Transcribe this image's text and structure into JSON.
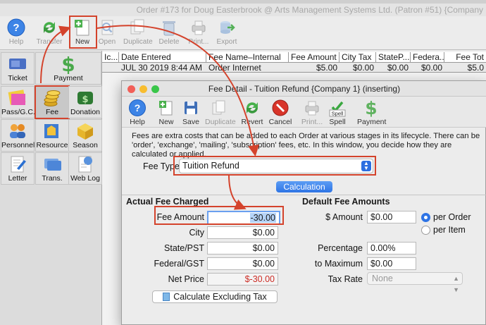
{
  "order_window": {
    "title": "Order #173 for Doug Easterbrook @ Arts Management Systems Ltd. (Patron #51) {Company",
    "toolbar": [
      {
        "id": "help",
        "label": "Help"
      },
      {
        "id": "transfer",
        "label": "Transfer"
      },
      {
        "id": "new",
        "label": "New"
      },
      {
        "id": "open",
        "label": "Open"
      },
      {
        "id": "duplicate",
        "label": "Duplicate"
      },
      {
        "id": "delete",
        "label": "Delete"
      },
      {
        "id": "print",
        "label": "Print..."
      },
      {
        "id": "export",
        "label": "Export"
      }
    ],
    "modules": [
      {
        "id": "ticket",
        "label": "Ticket"
      },
      {
        "id": "payment",
        "label": "Payment"
      },
      {
        "id": "pass",
        "label": "Pass/G.C."
      },
      {
        "id": "fee",
        "label": "Fee"
      },
      {
        "id": "donation",
        "label": "Donation"
      },
      {
        "id": "personnel",
        "label": "Personnel"
      },
      {
        "id": "resource",
        "label": "Resource"
      },
      {
        "id": "season",
        "label": "Season"
      },
      {
        "id": "letter",
        "label": "Letter"
      },
      {
        "id": "trans",
        "label": "Trans."
      },
      {
        "id": "weblog",
        "label": "Web Log"
      }
    ],
    "table": {
      "columns": [
        "Ic...",
        "Date Entered",
        "Fee Name–Internal",
        "Fee Amount",
        "City Tax",
        "StateP...",
        "Federa...",
        "Fee Tot"
      ],
      "rows": [
        [
          "",
          "JUL 30 2019 8:44 AM",
          "Order Internet",
          "$5.00",
          "$0.00",
          "$0.00",
          "$0.00",
          "$5.0"
        ]
      ]
    }
  },
  "dialog": {
    "title": "Fee Detail - Tuition Refund {Company 1} (inserting)",
    "toolbar": [
      {
        "id": "help",
        "label": "Help"
      },
      {
        "id": "new",
        "label": "New"
      },
      {
        "id": "save",
        "label": "Save"
      },
      {
        "id": "duplicate",
        "label": "Duplicate"
      },
      {
        "id": "revert",
        "label": "Revert"
      },
      {
        "id": "cancel",
        "label": "Cancel"
      },
      {
        "id": "print",
        "label": "Print..."
      },
      {
        "id": "spell",
        "label": "Spell",
        "badge": "Spell"
      },
      {
        "id": "payment",
        "label": "Payment"
      }
    ],
    "info_text": "Fees are extra costs that can be added to each Order at various stages in its lifecycle.  There can be 'order', 'exchange', 'mailing', 'subscription' fees, etc.   In this window, you decide how they are calculated or applied.",
    "fee_type": {
      "label": "Fee Type",
      "value": "Tuition Refund"
    },
    "calculation_tab": "Calculation",
    "actual": {
      "title": "Actual Fee Charged",
      "fee_amount": {
        "label": "Fee Amount",
        "value": "-30.00"
      },
      "city": {
        "label": "City",
        "value": "$0.00"
      },
      "state": {
        "label": "State/PST",
        "value": "$0.00"
      },
      "federal": {
        "label": "Federal/GST",
        "value": "$0.00"
      },
      "net": {
        "label": "Net Price",
        "value": "$-30.00"
      },
      "calc_button": "Calculate Excluding Tax"
    },
    "defaults": {
      "title": "Default Fee Amounts",
      "amount": {
        "label": "$ Amount",
        "value": "$0.00"
      },
      "per_order": "per Order",
      "per_item": "per Item",
      "percentage": {
        "label": "Percentage",
        "value": "0.00%"
      },
      "to_maximum": {
        "label": "to Maximum",
        "value": "$0.00"
      },
      "tax_rate": {
        "label": "Tax Rate",
        "value": "None"
      }
    }
  },
  "colors": {
    "highlight": "#d4432c",
    "accent": "#2e74e5",
    "negative": "#cc2c25"
  }
}
